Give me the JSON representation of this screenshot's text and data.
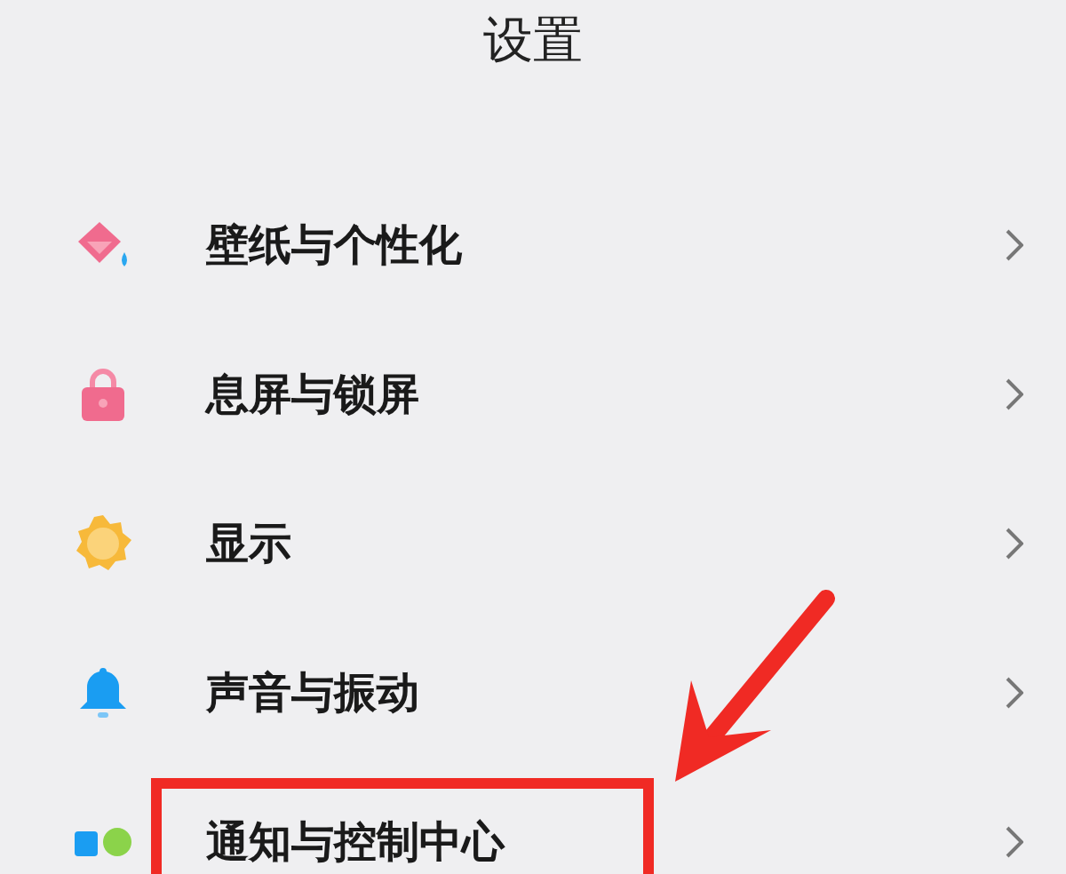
{
  "header": {
    "title": "设置"
  },
  "items": [
    {
      "label": "壁纸与个性化",
      "highlighted": false
    },
    {
      "label": "息屏与锁屏",
      "highlighted": false
    },
    {
      "label": "显示",
      "highlighted": false
    },
    {
      "label": "声音与振动",
      "highlighted": false
    },
    {
      "label": "通知与控制中心",
      "highlighted": true
    }
  ]
}
